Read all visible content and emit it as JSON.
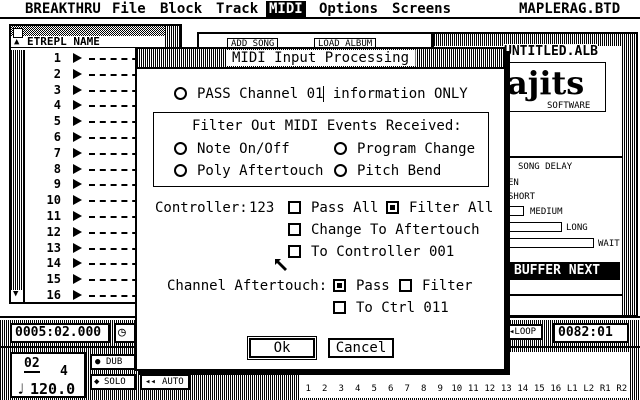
{
  "menubar": {
    "app": "BREAKTHRU",
    "items": [
      "File",
      "Block",
      "Track",
      "MIDI",
      "Options",
      "Screens"
    ],
    "active": "MIDI",
    "filename": "MAPLERAG.BTD"
  },
  "tracks": {
    "header": "ETREPL NAME",
    "numbers": [
      "1",
      "2",
      "3",
      "4",
      "5",
      "6",
      "7",
      "8",
      "9",
      "10",
      "11",
      "12",
      "13",
      "14",
      "15",
      "16"
    ]
  },
  "background": {
    "add_song": "ADD SONG",
    "load_album": "LOAD ALBUM",
    "album_name": "UNTITLED.ALB",
    "logo_text": "ajits",
    "logo_sub": "SOFTWARE",
    "song_delay": "SONG DELAY",
    "delay_opts": [
      "EN",
      "SHORT",
      "MEDIUM",
      "LONG",
      "WAIT"
    ],
    "buffer_next": "BUFFER NEXT",
    "position": "0005:02.000",
    "loop": "LOOP",
    "end_pos": "0082:01",
    "time_sig_top": "02",
    "time_sig_bottom": "4",
    "tempo": "120.0",
    "dub": "DUB",
    "solo": "SOLO",
    "auto": "AUTO",
    "channels": [
      "1",
      "2",
      "3",
      "4",
      "5",
      "6",
      "7",
      "8",
      "9",
      "10",
      "11",
      "12",
      "13",
      "14",
      "15",
      "16",
      "L1",
      "L2",
      "R1",
      "R2"
    ]
  },
  "dialog": {
    "title": "MIDI Input Processing",
    "pass_channel_prefix": "PASS Channel ",
    "pass_channel_num": "01",
    "pass_channel_suffix": " information ONLY",
    "filter_heading": "Filter Out MIDI Events Received:",
    "note_onoff": "Note On/Off",
    "program_change": "Program Change",
    "poly_aftertouch": "Poly Aftertouch",
    "pitch_bend": "Pitch Bend",
    "controller_label": "Controller:",
    "controller_num": "123",
    "pass_all": "Pass All",
    "filter_all": "Filter All",
    "change_aftertouch": "Change To Aftertouch",
    "to_controller": "To Controller 001",
    "channel_aftertouch": "Channel Aftertouch:",
    "pass": "Pass",
    "filter": "Filter",
    "to_ctrl": "To Ctrl 011",
    "ok": "Ok",
    "cancel": "Cancel"
  }
}
